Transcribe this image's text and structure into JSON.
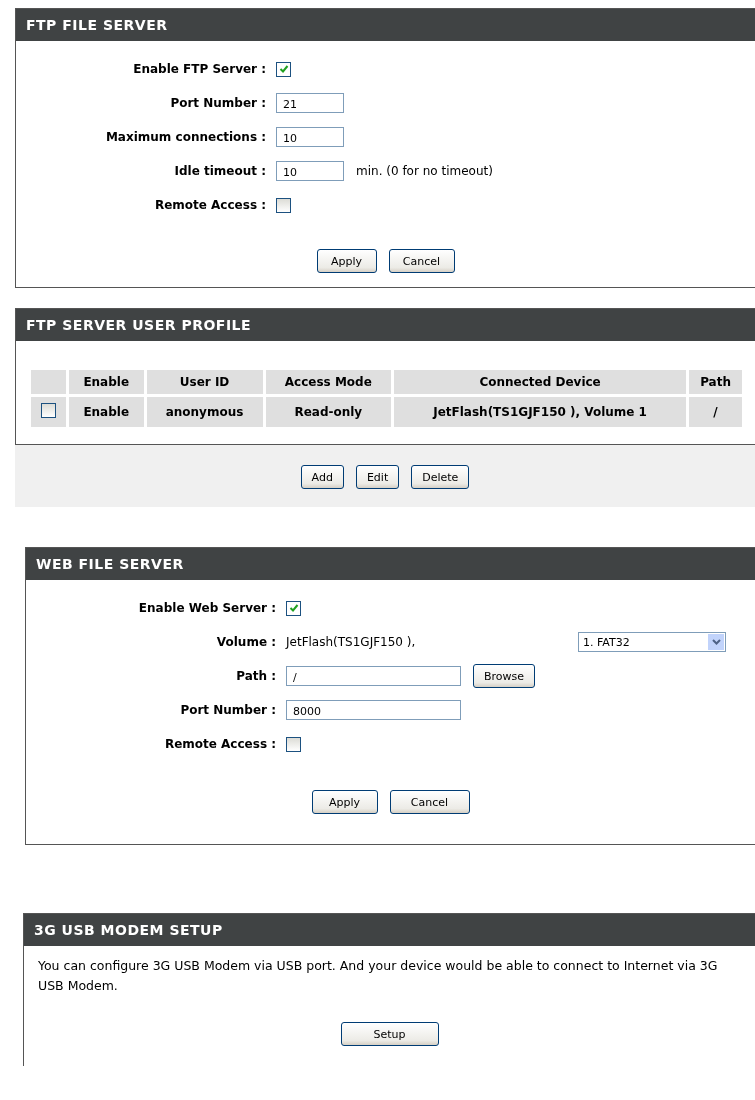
{
  "ftp_server": {
    "title": "FTP FILE SERVER",
    "fields": [
      {
        "kind": "checkbox",
        "label": "Enable FTP Server :",
        "checked": true
      },
      {
        "kind": "input",
        "label": "Port Number :",
        "value": "21"
      },
      {
        "kind": "input",
        "label": "Maximum connections :",
        "value": "10"
      },
      {
        "kind": "input",
        "label": "Idle timeout :",
        "value": "10",
        "note": "min. (0 for no timeout)"
      },
      {
        "kind": "checkbox",
        "label": "Remote Access :",
        "checked": false
      }
    ],
    "buttons": [
      "Apply",
      "Cancel"
    ]
  },
  "user_profile": {
    "title": "FTP SERVER USER PROFILE",
    "table": {
      "columns": [
        "",
        "Enable",
        "User ID",
        "Access Mode",
        "Connected Device",
        "Path"
      ],
      "rows": [
        {
          "cells": [
            {
              "kind": "checkbox",
              "checked": false
            },
            {
              "kind": "text",
              "text": "Enable"
            },
            {
              "kind": "text",
              "text": "anonymous"
            },
            {
              "kind": "text",
              "text": "Read-only"
            },
            {
              "kind": "text",
              "text": "JetFlash(TS1GJF150 ), Volume 1"
            },
            {
              "kind": "text",
              "text": "/"
            }
          ]
        }
      ]
    },
    "buttons": [
      "Add",
      "Edit",
      "Delete"
    ]
  },
  "web_server": {
    "title": "WEB FILE SERVER",
    "fields": [
      {
        "kind": "checkbox",
        "label": "Enable Web Server :",
        "checked": true
      },
      {
        "kind": "text",
        "label": "Volume :",
        "value": "JetFlash(TS1GJF150 ),",
        "select": "1. FAT32"
      },
      {
        "kind": "input",
        "label": "Path :",
        "value": "/",
        "button": "Browse"
      },
      {
        "kind": "input",
        "label": "Port Number :",
        "value": "8000"
      },
      {
        "kind": "checkbox",
        "label": "Remote Access :",
        "checked": false
      }
    ],
    "buttons": [
      "Apply",
      "Cancel"
    ]
  },
  "modem": {
    "title": "3G USB MODEM SETUP",
    "text": "You can configure 3G USB Modem via USB port. And your device would be able to connect to Internet via 3G USB Modem.",
    "button": "Setup"
  }
}
